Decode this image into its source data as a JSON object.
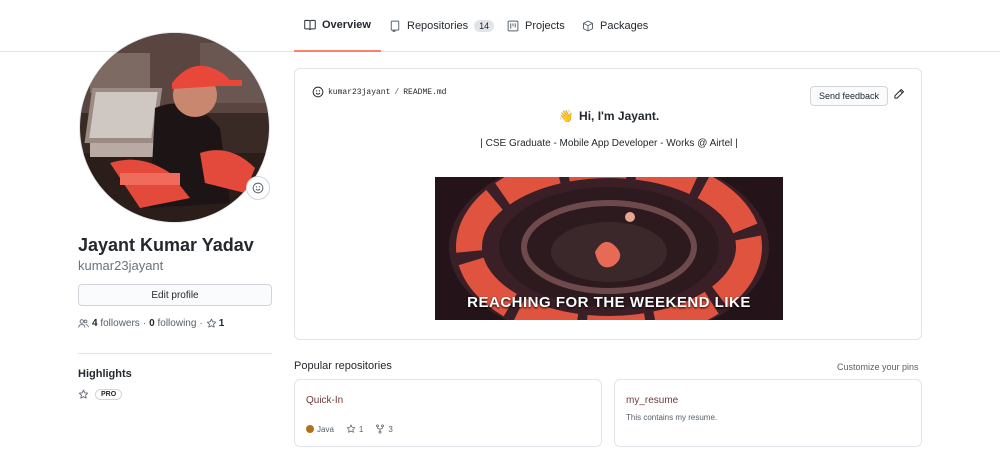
{
  "tabs": [
    {
      "label": "Overview",
      "icon": "book-icon",
      "active": true
    },
    {
      "label": "Repositories",
      "icon": "repo-icon",
      "count": "14"
    },
    {
      "label": "Projects",
      "icon": "project-icon"
    },
    {
      "label": "Packages",
      "icon": "package-icon"
    }
  ],
  "profile": {
    "fullname": "Jayant Kumar Yadav",
    "login": "kumar23jayant",
    "edit_label": "Edit profile",
    "followers_count": "4",
    "followers_label": "followers",
    "following_count": "0",
    "following_label": "following",
    "stars_count": "1"
  },
  "highlights": {
    "title": "Highlights",
    "badge": "PRO"
  },
  "readme": {
    "owner": "kumar23jayant",
    "separator": "/",
    "file": "README.md",
    "feedback_label": "Send feedback",
    "wave": "👋",
    "greeting": "Hi, I'm Jayant.",
    "tagline": "| CSE Graduate - Mobile App Developer - Works @ Airtel |",
    "gif_caption": "REACHING FOR THE WEEKEND LIKE"
  },
  "popular": {
    "title": "Popular repositories",
    "customize_label": "Customize your pins",
    "repos": [
      {
        "name": "Quick-In",
        "description": "",
        "language": "Java",
        "language_color": "#b07219",
        "stars": "1",
        "forks": "3"
      },
      {
        "name": "my_resume",
        "description": "This contains my resume."
      }
    ]
  },
  "colors": {
    "active_tab_underline": "#f9826c",
    "repo_link": "#6f3a3a",
    "border": "#e1e4e8"
  }
}
